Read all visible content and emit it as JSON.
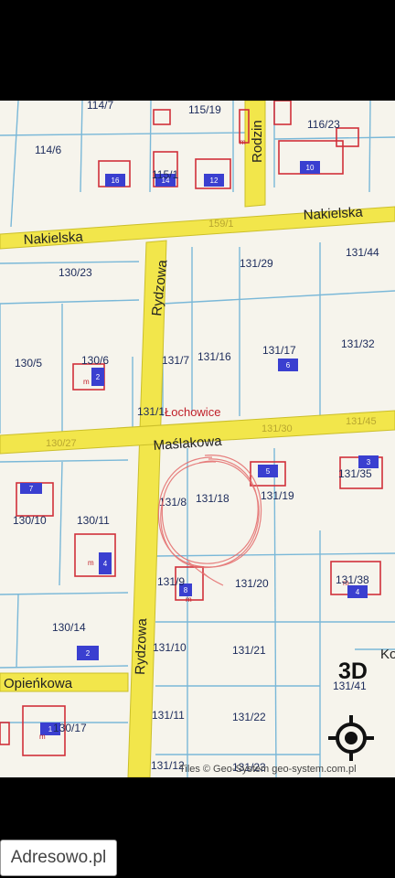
{
  "map": {
    "place_label": "Łochowice",
    "attribution": "Tiles © Geo-System geo-system.com.pl",
    "streets": {
      "nakielska_left": "Nakielska",
      "nakielska_right": "Nakielska",
      "rydzowa_top": "Rydzowa",
      "rydzowa_bottom": "Rydzowa",
      "maslakowa": "Maślakowa",
      "opienkowa": "Opieńkowa",
      "ko_partial": "Ko",
      "rodzinna_partial": "Rodzin"
    },
    "road_numbers": {
      "nakielska": "159/1",
      "maslakowa_right": "131/30",
      "maslakowa_left": "130/27",
      "maslakowa_far": "131/45"
    },
    "parcels": {
      "p114_7": "114/7",
      "p115_19": "115/19",
      "p116_23": "116/23",
      "p114_6": "114/6",
      "p115_1": "115/1",
      "p130_23": "130/23",
      "p131_29": "131/29",
      "p131_44": "131/44",
      "p130_5": "130/5",
      "p130_6": "130/6",
      "p131_7": "131/7",
      "p131_16": "131/16",
      "p131_17": "131/17",
      "p131_32": "131/32",
      "p131_1x": "131/1",
      "p131_35": "131/35",
      "p130_10": "130/10",
      "p130_11": "130/11",
      "p131_8": "131/8",
      "p131_18": "131/18",
      "p131_19": "131/19",
      "p131_9": "131/9",
      "p131_20": "131/20",
      "p131_38": "131/38",
      "p130_14": "130/14",
      "p131_10": "131/10",
      "p131_21": "131/21",
      "p130_17": "130/17",
      "p131_11": "131/11",
      "p131_22": "131/22",
      "p131_41": "131/41",
      "p131_12": "131/12",
      "p131_23": "131/23"
    },
    "house_numbers": {
      "h16": "16",
      "h14": "14",
      "h12": "12",
      "h10": "10",
      "h2a": "2",
      "h6": "6",
      "h7": "7",
      "h5": "5",
      "h3": "3",
      "h4a": "4",
      "h8": "8",
      "h4b": "4",
      "h2b": "2",
      "h1": "1"
    },
    "building_letter": "m",
    "colors": {
      "background": "#f6f4ec",
      "road": "#f2e64b",
      "parcel_line": "#7ab8d8",
      "building_outline": "#d0303a",
      "house_marker": "#3a3fd0",
      "annotation_scribble": "#e46b6b"
    }
  },
  "controls": {
    "three_d_label": "3D",
    "locate_icon": "locate-crosshair-icon"
  },
  "brand": {
    "label": "Adresowo.pl"
  }
}
